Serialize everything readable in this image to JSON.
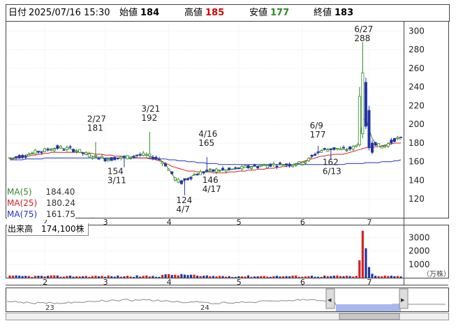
{
  "header": {
    "date_label": "日付",
    "datetime": "2025/07/16 15:30",
    "open_label": "始値",
    "open_value": "184",
    "high_label": "高値",
    "high_value": "185",
    "low_label": "安値",
    "low_value": "177",
    "close_label": "終値",
    "close_value": "183"
  },
  "legend": {
    "ma5": "MA(5)",
    "ma5_value": "184.40",
    "ma25": "MA(25)",
    "ma25_value": "180.24",
    "ma75": "MA(75)",
    "ma75_value": "161.75"
  },
  "volume_label": "出来高　174,100株",
  "colors": {
    "up": "#2e8b22",
    "down": "#2233aa",
    "ma5": "#2e8b22",
    "ma25": "#d42020",
    "ma75": "#2233cc",
    "volume_up": "#d42020",
    "volume_down": "#2233aa",
    "overview_fill": "#a8b8ee"
  },
  "chart_data": [
    {
      "type": "candlestick",
      "ylim": [
        100,
        310
      ],
      "y_ticks": [
        120,
        140,
        160,
        180,
        200,
        220,
        240,
        260,
        280,
        300
      ],
      "x_tick_labels": [
        {
          "label": "2",
          "index": 11
        },
        {
          "label": "3",
          "index": 30
        },
        {
          "label": "4",
          "index": 50
        },
        {
          "label": "5",
          "index": 72
        },
        {
          "label": "6",
          "index": 92
        },
        {
          "label": "7",
          "index": 113
        }
      ],
      "annotations": [
        {
          "index": 27,
          "value": 193,
          "date": "2/27",
          "price": "181",
          "pos": "above"
        },
        {
          "index": 44,
          "value": 204,
          "date": "3/21",
          "price": "192",
          "pos": "above"
        },
        {
          "index": 36,
          "value": 154,
          "date": "3/11",
          "price": "154",
          "pos": "below-left"
        },
        {
          "index": 62,
          "value": 177,
          "date": "4/16",
          "price": "165",
          "pos": "above"
        },
        {
          "index": 55,
          "value": 123,
          "date": "4/7",
          "price": "124",
          "pos": "below"
        },
        {
          "index": 61,
          "value": 145,
          "date": "4/17",
          "price": "146",
          "pos": "below-right"
        },
        {
          "index": 97,
          "value": 186,
          "date": "6/9",
          "price": "177",
          "pos": "above"
        },
        {
          "index": 101,
          "value": 164,
          "date": "6/13",
          "price": "162",
          "pos": "below"
        },
        {
          "index": 111,
          "value": 289,
          "date": "6/27",
          "price": "288",
          "pos": "above"
        }
      ],
      "ma5_series": [
        164,
        164,
        165,
        166,
        166,
        167,
        168,
        169,
        170,
        171,
        171,
        172,
        173,
        174,
        174,
        175,
        175,
        174,
        174,
        174,
        173,
        172,
        171,
        169,
        168,
        167,
        166,
        165,
        165,
        164,
        163,
        163,
        163,
        164,
        164,
        164,
        165,
        165,
        165,
        166,
        167,
        167,
        167,
        167,
        166,
        165,
        164,
        163,
        160,
        157,
        152,
        147,
        142,
        139,
        138,
        140,
        142,
        144,
        146,
        147,
        148,
        149,
        150,
        150,
        150,
        151,
        151,
        151,
        151,
        151,
        152,
        152,
        153,
        153,
        154,
        154,
        155,
        155,
        155,
        156,
        156,
        156,
        157,
        157,
        157,
        157,
        157,
        157,
        157,
        157,
        158,
        158,
        159,
        160,
        162,
        165,
        168,
        170,
        172,
        173,
        173,
        174,
        174,
        174,
        173,
        173,
        173,
        174,
        175,
        177,
        182,
        205,
        206,
        195,
        185,
        180,
        177,
        176,
        177,
        179,
        181,
        184,
        185,
        184
      ],
      "ma25_series": [
        163,
        163,
        164,
        164,
        165,
        166,
        166,
        167,
        167,
        168,
        168,
        169,
        169,
        170,
        170,
        170,
        170,
        170,
        170,
        170,
        170,
        170,
        170,
        170,
        169,
        169,
        169,
        168,
        168,
        168,
        167,
        167,
        167,
        166,
        166,
        166,
        165,
        165,
        165,
        165,
        164,
        164,
        164,
        164,
        163,
        163,
        162,
        161,
        160,
        158,
        157,
        155,
        154,
        153,
        152,
        151,
        150,
        150,
        150,
        149,
        149,
        149,
        149,
        149,
        148,
        148,
        148,
        148,
        148,
        149,
        149,
        149,
        150,
        150,
        150,
        151,
        151,
        151,
        152,
        152,
        152,
        153,
        153,
        153,
        154,
        154,
        155,
        155,
        156,
        157,
        158,
        159,
        160,
        161,
        162,
        163,
        164,
        165,
        166,
        166,
        167,
        167,
        168,
        168,
        168,
        168,
        169,
        170,
        171,
        172,
        173,
        174,
        175,
        175,
        175,
        176,
        176,
        177,
        178,
        178,
        179,
        180,
        180,
        180
      ],
      "ma75_series": [
        162,
        162,
        162,
        162,
        162,
        163,
        163,
        163,
        163,
        163,
        163,
        164,
        164,
        164,
        164,
        164,
        164,
        164,
        164,
        164,
        164,
        164,
        164,
        164,
        164,
        164,
        164,
        164,
        164,
        164,
        164,
        164,
        164,
        164,
        164,
        164,
        164,
        164,
        164,
        164,
        164,
        164,
        164,
        164,
        164,
        164,
        163,
        163,
        163,
        163,
        162,
        162,
        162,
        161,
        161,
        161,
        160,
        160,
        160,
        159,
        159,
        159,
        158,
        158,
        158,
        158,
        157,
        157,
        157,
        157,
        157,
        157,
        157,
        157,
        157,
        157,
        157,
        157,
        157,
        157,
        157,
        157,
        157,
        157,
        157,
        157,
        157,
        157,
        157,
        157,
        157,
        157,
        157,
        157,
        157,
        157,
        157,
        157,
        157,
        157,
        157,
        157,
        157,
        157,
        157,
        157,
        158,
        158,
        158,
        158,
        158,
        158,
        159,
        159,
        159,
        159,
        159,
        160,
        160,
        160,
        160,
        161,
        161,
        162
      ],
      "volume_ylim": [
        0,
        3900
      ],
      "volume_ticks": [
        1000,
        2000,
        3000
      ],
      "volume_unit": "（万株）"
    },
    {
      "type": "area",
      "x_tick_labels": [
        {
          "label": "23",
          "pos": 0.09
        },
        {
          "label": "24",
          "pos": 0.44
        }
      ]
    }
  ]
}
